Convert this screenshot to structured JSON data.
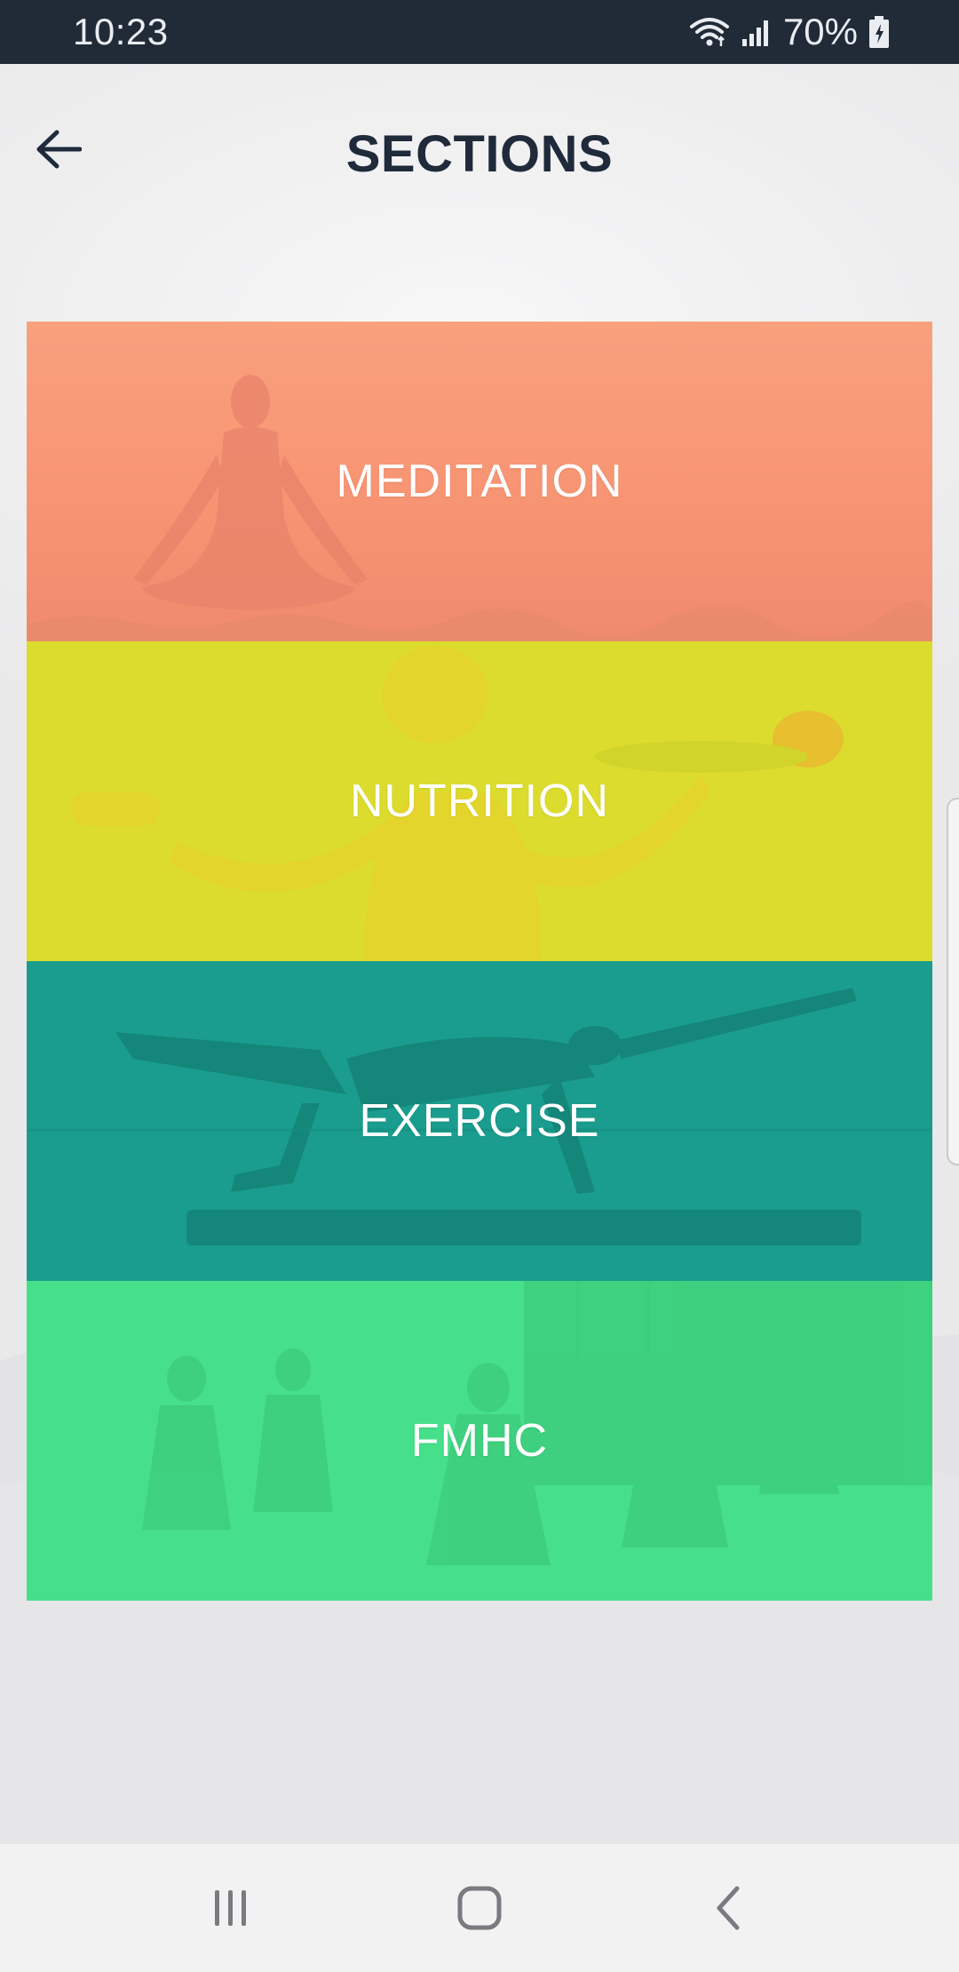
{
  "status_bar": {
    "time": "10:23",
    "battery_percent": "70%",
    "icons": [
      "wifi-icon",
      "signal-icon",
      "battery-charging-icon"
    ]
  },
  "header": {
    "title": "SECTIONS",
    "back_icon": "arrow-left-icon"
  },
  "sections": [
    {
      "label": "MEDITATION",
      "color": "#f79372"
    },
    {
      "label": "NUTRITION",
      "color": "#dcdc2e"
    },
    {
      "label": "EXERCISE",
      "color": "#1a9d8e"
    },
    {
      "label": "FMHC",
      "color": "#47e08a"
    }
  ],
  "nav_bar": {
    "icons": [
      "recent-apps-icon",
      "home-icon",
      "back-icon"
    ]
  },
  "colors": {
    "status_bar_bg": "#212a37",
    "title_text": "#1f2a3a",
    "page_bg": "#eeeeef"
  }
}
